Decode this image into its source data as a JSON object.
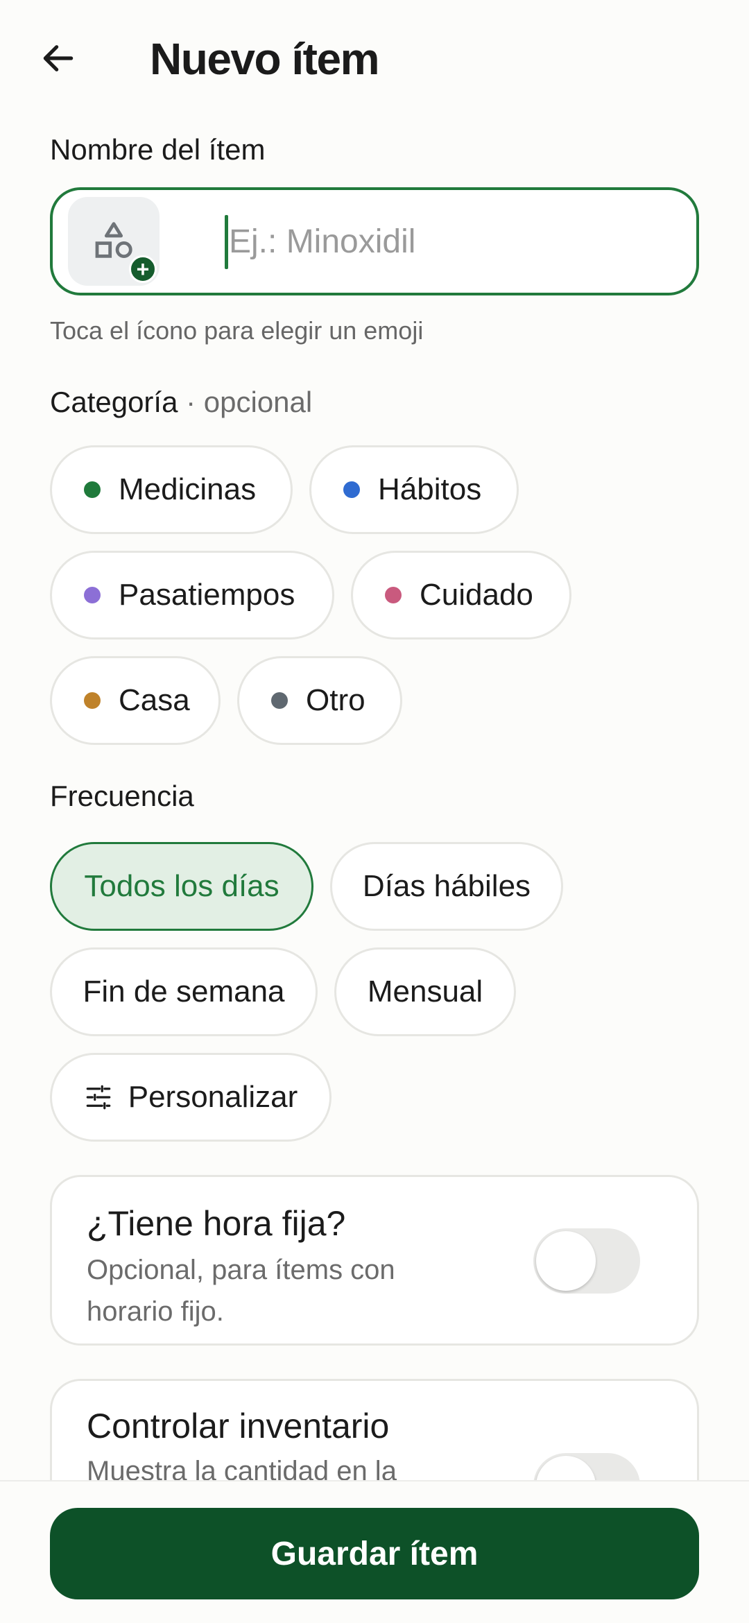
{
  "header": {
    "title": "Nuevo ítem",
    "back_icon": "arrow-left-icon"
  },
  "name_section": {
    "label": "Nombre del ítem",
    "placeholder": "Ej.: Minoxidil",
    "value": "",
    "emoji_icon": "shapes-icon",
    "emoji_add_icon": "plus-icon",
    "helper": "Toca el ícono para elegir un emoji"
  },
  "category_section": {
    "label": "Categoría",
    "optional": "· opcional",
    "chips": [
      {
        "label": "Medicinas",
        "color": "#1f7a3b"
      },
      {
        "label": "Hábitos",
        "color": "#2f6bd1"
      },
      {
        "label": "Pasatiempos",
        "color": "#8c6fd6"
      },
      {
        "label": "Cuidado",
        "color": "#c95a7e"
      },
      {
        "label": "Casa",
        "color": "#bf822a"
      },
      {
        "label": "Otro",
        "color": "#5f6870"
      }
    ]
  },
  "frequency_section": {
    "label": "Frecuencia",
    "selected": "Todos los días",
    "chips": [
      {
        "label": "Todos los días"
      },
      {
        "label": "Días hábiles"
      },
      {
        "label": "Fin de semana"
      },
      {
        "label": "Mensual"
      },
      {
        "label": "Personalizar",
        "icon": "tune-icon"
      }
    ]
  },
  "fixed_time": {
    "title": "¿Tiene hora fija?",
    "subtitle": "Opcional, para ítems con horario fijo.",
    "enabled": false
  },
  "inventory": {
    "title": "Controlar inventario",
    "subtitle": "Muestra la cantidad en la",
    "enabled": false
  },
  "footer": {
    "save_label": "Guardar ítem"
  },
  "colors": {
    "accent": "#217a3c",
    "primary_button": "#0d5128",
    "selected_chip_bg": "#e2efe4"
  }
}
